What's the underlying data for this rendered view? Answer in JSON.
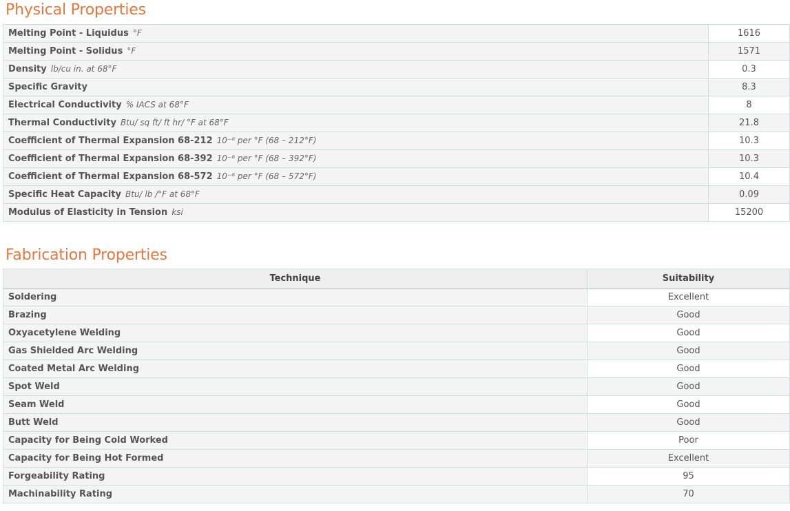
{
  "physical": {
    "title": "Physical Properties",
    "rows": [
      {
        "label": "Melting Point - Liquidus",
        "unit": "°F",
        "value": "1616"
      },
      {
        "label": "Melting Point - Solidus",
        "unit": "°F",
        "value": "1571"
      },
      {
        "label": "Density",
        "unit": "lb/cu in. at 68°F",
        "value": "0.3"
      },
      {
        "label": "Specific Gravity",
        "unit": "",
        "value": "8.3"
      },
      {
        "label": "Electrical Conductivity",
        "unit": "% IACS at 68°F",
        "value": "8"
      },
      {
        "label": "Thermal Conductivity",
        "unit": "Btu/ sq ft/ ft hr/ °F at 68°F",
        "value": "21.8"
      },
      {
        "label": "Coefficient of Thermal Expansion 68-212",
        "unit": "10⁻⁶ per °F (68 – 212°F)",
        "value": "10.3"
      },
      {
        "label": "Coefficient of Thermal Expansion 68-392",
        "unit": "10⁻⁶ per °F (68 – 392°F)",
        "value": "10.3"
      },
      {
        "label": "Coefficient of Thermal Expansion 68-572",
        "unit": "10⁻⁶ per °F (68 – 572°F)",
        "value": "10.4"
      },
      {
        "label": "Specific Heat Capacity",
        "unit": "Btu/ lb /°F at 68°F",
        "value": "0.09"
      },
      {
        "label": "Modulus of Elasticity in Tension",
        "unit": "ksi",
        "value": "15200"
      }
    ]
  },
  "fabrication": {
    "title": "Fabrication Properties",
    "headers": {
      "technique": "Technique",
      "suitability": "Suitability"
    },
    "rows": [
      {
        "label": "Soldering",
        "value": "Excellent"
      },
      {
        "label": "Brazing",
        "value": "Good"
      },
      {
        "label": "Oxyacetylene Welding",
        "value": "Good"
      },
      {
        "label": "Gas Shielded Arc Welding",
        "value": "Good"
      },
      {
        "label": "Coated Metal Arc Welding",
        "value": "Good"
      },
      {
        "label": "Spot Weld",
        "value": "Good"
      },
      {
        "label": "Seam Weld",
        "value": "Good"
      },
      {
        "label": "Butt Weld",
        "value": "Good"
      },
      {
        "label": "Capacity for Being Cold Worked",
        "value": "Poor"
      },
      {
        "label": "Capacity for Being Hot Formed",
        "value": "Excellent"
      },
      {
        "label": "Forgeability Rating",
        "value": "95"
      },
      {
        "label": "Machinability Rating",
        "value": "70"
      }
    ]
  }
}
